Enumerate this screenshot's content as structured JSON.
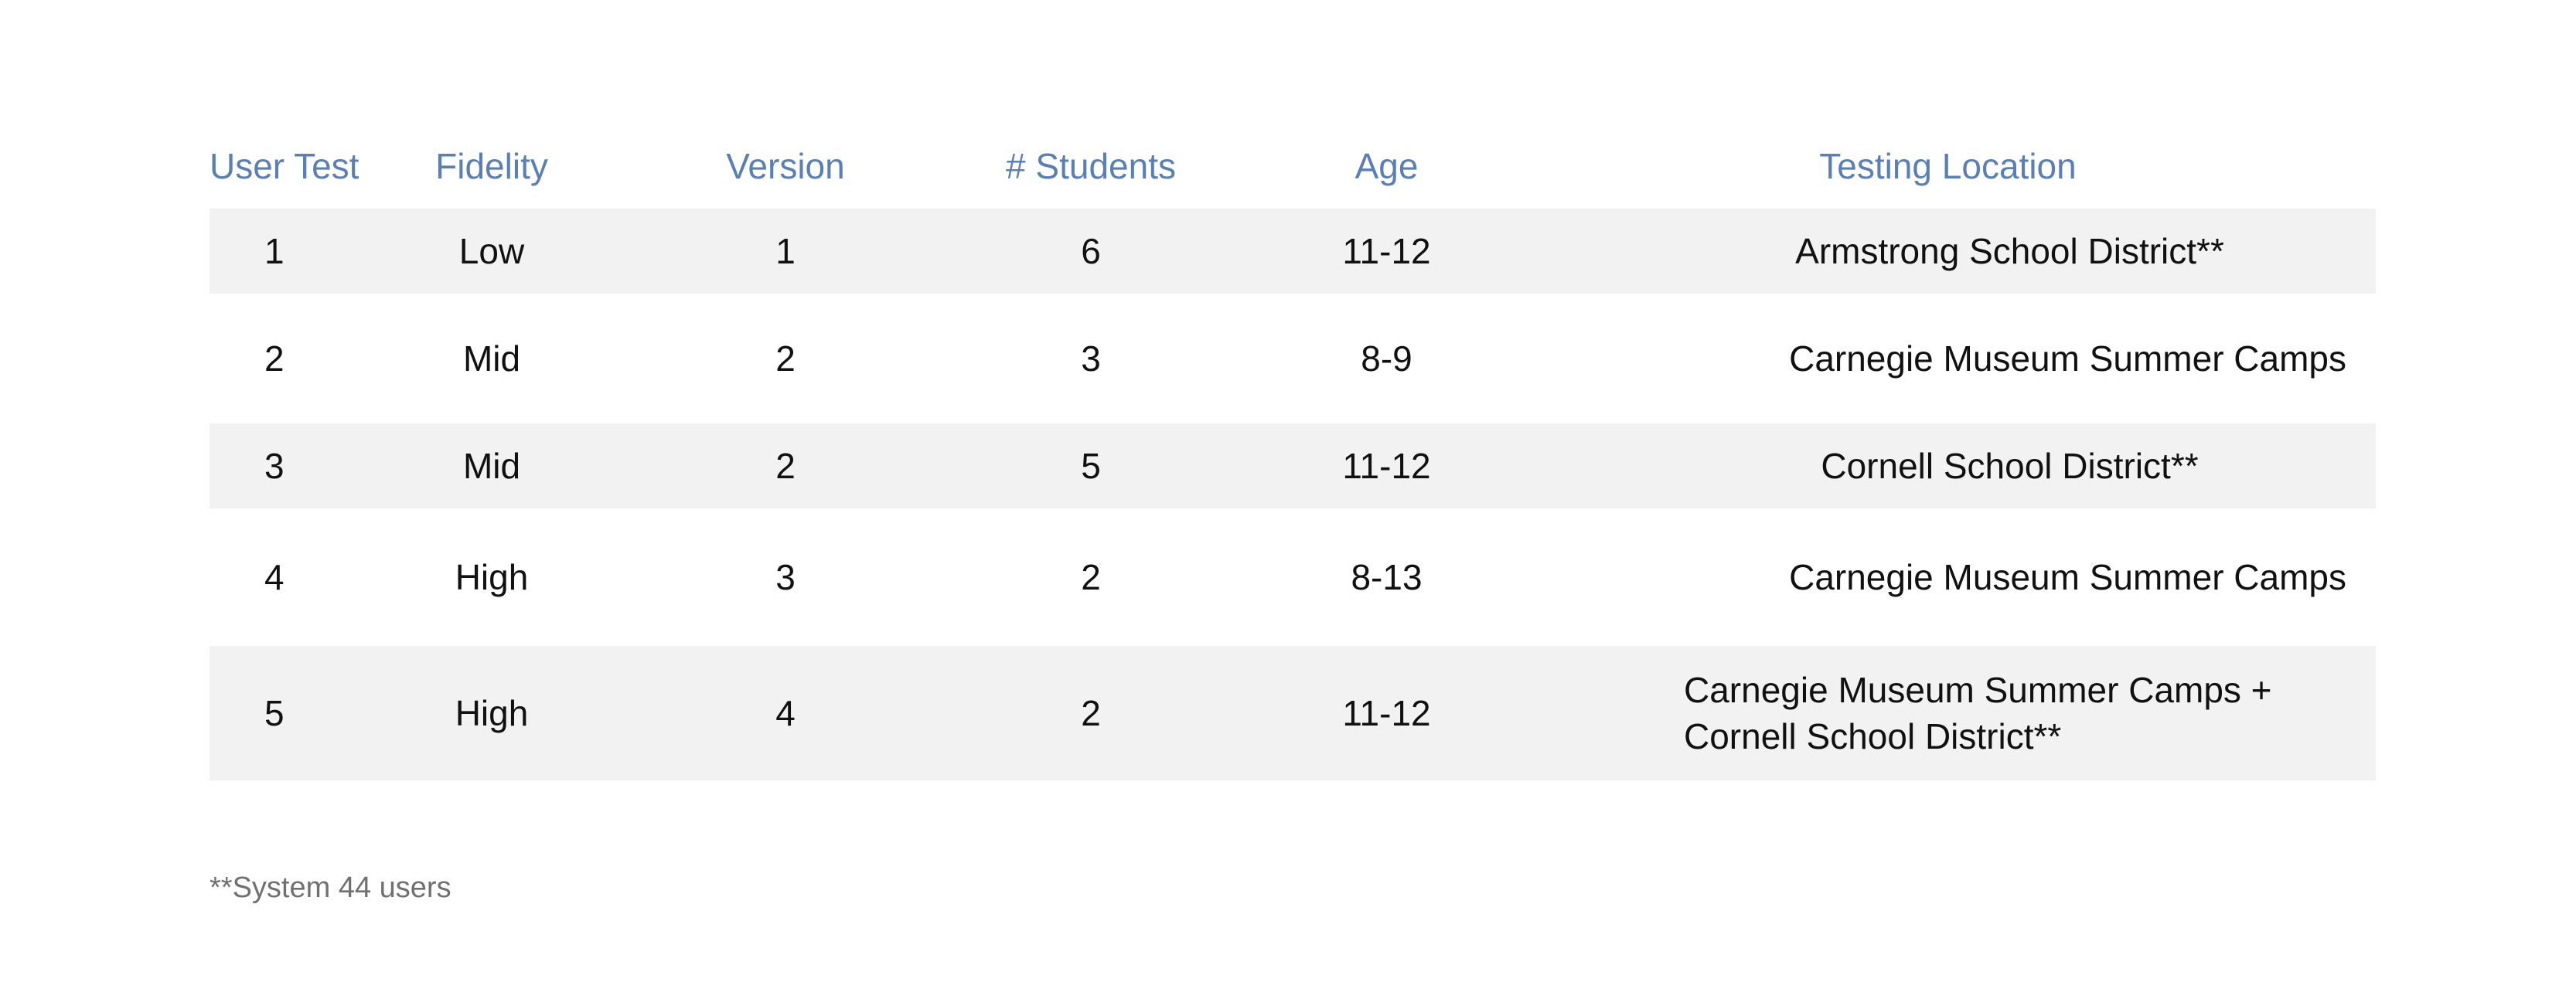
{
  "table": {
    "headers": [
      "User Test",
      "Fidelity",
      "Version",
      "# Students",
      "Age",
      "Testing Location"
    ],
    "rows": [
      {
        "user_test": "1",
        "fidelity": "Low",
        "version": "1",
        "students": "6",
        "age": "11-12",
        "location": "Armstrong School District**"
      },
      {
        "user_test": "2",
        "fidelity": "Mid",
        "version": "2",
        "students": "3",
        "age": "8-9",
        "location": "Carnegie Museum Summer Camps"
      },
      {
        "user_test": "3",
        "fidelity": "Mid",
        "version": "2",
        "students": "5",
        "age": "11-12",
        "location": "Cornell School District**"
      },
      {
        "user_test": "4",
        "fidelity": "High",
        "version": "3",
        "students": "2",
        "age": "8-13",
        "location": "Carnegie Museum Summer Camps"
      },
      {
        "user_test": "5",
        "fidelity": "High",
        "version": "4",
        "students": "2",
        "age": "11-12",
        "location_lines": [
          "Carnegie Museum Summer Camps +",
          "Cornell School District**"
        ]
      }
    ],
    "colors": {
      "header_text": "#5a7fb5",
      "row_shade": "#f2f2f2",
      "body_text": "#111111",
      "footnote_text": "#707070"
    }
  },
  "footnote": "**System 44 users"
}
